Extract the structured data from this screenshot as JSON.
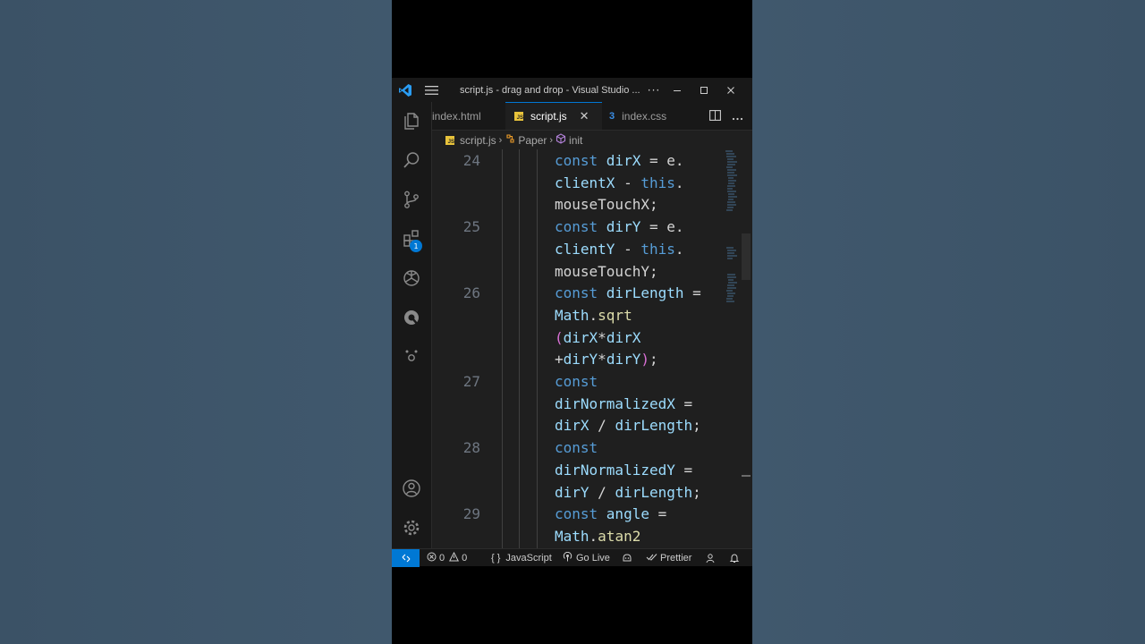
{
  "window": {
    "title": "script.js - drag and drop - Visual Studio ...",
    "more": "···"
  },
  "tabs": [
    {
      "label": "index.html",
      "active": false
    },
    {
      "label": "script.js",
      "active": true,
      "close": "✕"
    },
    {
      "label": "index.css",
      "active": false
    }
  ],
  "breadcrumb": {
    "file": "script.js",
    "class": "Paper",
    "method": "init"
  },
  "activity": {
    "extensions_badge": "1"
  },
  "editor": {
    "lines": [
      {
        "num": "24",
        "parts": [
          [
            {
              "t": "const ",
              "c": "kw"
            },
            {
              "t": "dirX",
              "c": "var"
            },
            {
              "t": " = e.",
              "c": "ident"
            }
          ],
          [
            {
              "t": "clientX",
              "c": "var"
            },
            {
              "t": " - ",
              "c": "ident"
            },
            {
              "t": "this",
              "c": "this"
            },
            {
              "t": ".",
              "c": "ident"
            }
          ],
          [
            {
              "t": "mouseTouchX;",
              "c": "ident"
            }
          ]
        ]
      },
      {
        "num": "25",
        "parts": [
          [
            {
              "t": "const ",
              "c": "kw"
            },
            {
              "t": "dirY",
              "c": "var"
            },
            {
              "t": " = e.",
              "c": "ident"
            }
          ],
          [
            {
              "t": "clientY",
              "c": "var"
            },
            {
              "t": " - ",
              "c": "ident"
            },
            {
              "t": "this",
              "c": "this"
            },
            {
              "t": ".",
              "c": "ident"
            }
          ],
          [
            {
              "t": "mouseTouchY;",
              "c": "ident"
            }
          ]
        ]
      },
      {
        "num": "26",
        "parts": [
          [
            {
              "t": "const ",
              "c": "kw"
            },
            {
              "t": "dirLength",
              "c": "var"
            },
            {
              "t": " =",
              "c": "ident"
            }
          ],
          [
            {
              "t": "Math",
              "c": "var"
            },
            {
              "t": ".",
              "c": "ident"
            },
            {
              "t": "sqrt",
              "c": "fn"
            }
          ],
          [
            {
              "t": "(",
              "c": "paren"
            },
            {
              "t": "dirX",
              "c": "var"
            },
            {
              "t": "*",
              "c": "ident"
            },
            {
              "t": "dirX",
              "c": "var"
            }
          ],
          [
            {
              "t": "+",
              "c": "ident"
            },
            {
              "t": "dirY",
              "c": "var"
            },
            {
              "t": "*",
              "c": "ident"
            },
            {
              "t": "dirY",
              "c": "var"
            },
            {
              "t": ")",
              "c": "paren"
            },
            {
              "t": ";",
              "c": "ident"
            }
          ]
        ]
      },
      {
        "num": "27",
        "parts": [
          [
            {
              "t": "const",
              "c": "kw"
            }
          ],
          [
            {
              "t": "dirNormalizedX",
              "c": "var"
            },
            {
              "t": " =",
              "c": "ident"
            }
          ],
          [
            {
              "t": "dirX",
              "c": "var"
            },
            {
              "t": " / ",
              "c": "ident"
            },
            {
              "t": "dirLength",
              "c": "var"
            },
            {
              "t": ";",
              "c": "ident"
            }
          ]
        ]
      },
      {
        "num": "28",
        "parts": [
          [
            {
              "t": "const",
              "c": "kw"
            }
          ],
          [
            {
              "t": "dirNormalizedY",
              "c": "var"
            },
            {
              "t": " =",
              "c": "ident"
            }
          ],
          [
            {
              "t": "dirY",
              "c": "var"
            },
            {
              "t": " / ",
              "c": "ident"
            },
            {
              "t": "dirLength",
              "c": "var"
            },
            {
              "t": ";",
              "c": "ident"
            }
          ]
        ]
      },
      {
        "num": "29",
        "parts": [
          [
            {
              "t": "const ",
              "c": "kw"
            },
            {
              "t": "angle",
              "c": "var"
            },
            {
              "t": " =",
              "c": "ident"
            }
          ],
          [
            {
              "t": "Math",
              "c": "var"
            },
            {
              "t": ".",
              "c": "ident"
            },
            {
              "t": "atan2",
              "c": "fn"
            }
          ]
        ]
      }
    ]
  },
  "status": {
    "errors": "0",
    "warnings": "0",
    "language": "JavaScript",
    "golive": "Go Live",
    "prettier": "Prettier"
  },
  "colors": {
    "accent": "#0078d4",
    "keyword": "#569cd6",
    "variable": "#9cdcfe",
    "function": "#dcdcaa",
    "paren": "#da70d6"
  }
}
